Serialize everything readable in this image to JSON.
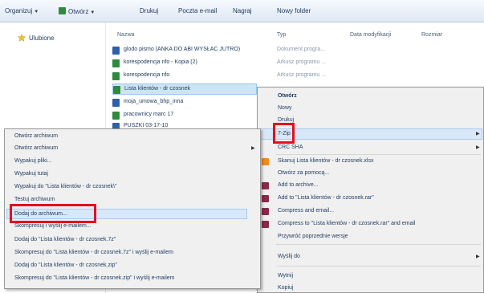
{
  "toolbar": {
    "organize": "Organizuj",
    "open": "Otwórz",
    "print": "Drukuj",
    "email": "Poczta e-mail",
    "burn": "Nagraj",
    "new_folder": "Nowy folder"
  },
  "nav": {
    "favorites": "Ulubione"
  },
  "columns": {
    "name": "Nazwa",
    "type": "Typ",
    "date": "Data modyfikacji",
    "size": "Rozmiar"
  },
  "files": [
    {
      "name": "glodo pismo (ANKA DO ABI WYSŁAC JUTRO)",
      "type": "Dokument progra..."
    },
    {
      "name": "korespodencja nfo - Kopia (2)",
      "type": "Arkusz programu ..."
    },
    {
      "name": "korespodencja nfo",
      "type": "Arkusz programu ..."
    },
    {
      "name": "Lista klientów - dr czosnek",
      "type": ""
    },
    {
      "name": "moja_umowa_bhp_inna",
      "type": ""
    },
    {
      "name": "pracownicy marc 17",
      "type": ""
    },
    {
      "name": "PUSZKI 03-17-10",
      "type": ""
    }
  ],
  "context_menu": {
    "items": [
      "Otwórz",
      "Nowy",
      "Drukuj",
      "7-Zip",
      "CRC SHA",
      "Skanuj Lista klientów - dr czosnek.xlsx",
      "Otwórz za pomocą...",
      "Add to archive...",
      "Add to \"Lista klientów - dr czosnek.rar\"",
      "Compress and email...",
      "Compress to \"Lista klientów - dr czosnek.rar\" and email",
      "Przywróć poprzednie wersje",
      "Wyślij do",
      "Wytnij",
      "Kopiuj"
    ]
  },
  "submenu": {
    "items": [
      "Otwórz archiwum",
      "Otwórz archiwum",
      "Wypakuj pliki...",
      "Wypakuj tutaj",
      "Wypakuj do \"Lista klientów - dr czosnek\\\"",
      "Testuj archiwum",
      "Dodaj do archiwum...",
      "Skompresuj i wyślij e-mailem...",
      "Dodaj do \"Lista klientów - dr czosnek.7z\"",
      "Skompresuj do \"Lista klientów - dr czosnek.7z\" i wyślij e-mailem",
      "Dodaj do \"Lista klientów - dr czosnek.zip\"",
      "Skompresuj do \"Lista klientów - dr czosnek.zip\" i wyślij e-mailem"
    ]
  },
  "colors": {
    "highlight_red": "#e3101e",
    "selection_blue": "#cde4f7",
    "menu_bg": "#f0f0f0"
  }
}
